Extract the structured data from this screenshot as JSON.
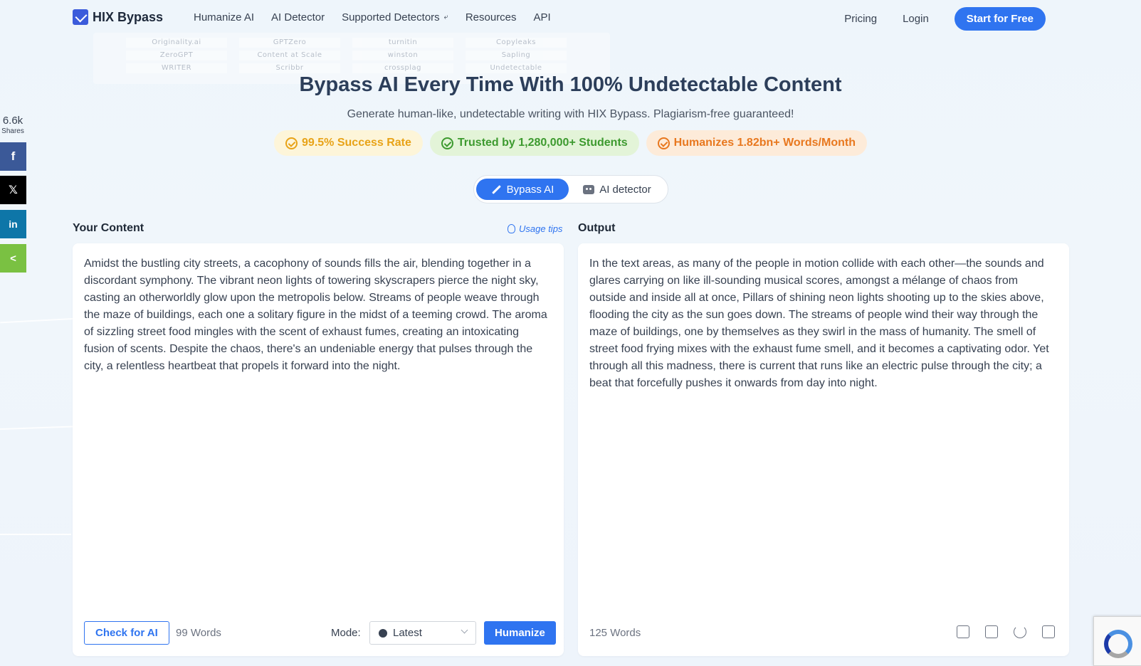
{
  "header": {
    "logo_text": "HIX Bypass",
    "nav": [
      "Humanize AI",
      "AI Detector",
      "Supported Detectors",
      "Resources",
      "API"
    ],
    "pricing": "Pricing",
    "login": "Login",
    "cta": "Start for Free"
  },
  "detectors": [
    "Originality.ai",
    "GPTZero",
    "turnitin",
    "Copyleaks",
    "ZeroGPT",
    "Content at Scale",
    "winston",
    "Sapling",
    "WRITER",
    "Scribbr",
    "crossplag",
    "Undetectable"
  ],
  "hero": {
    "title": "Bypass AI Every Time With 100% Undetectable Content",
    "subtitle": "Generate human-like, undetectable writing with HIX Bypass. Plagiarism-free guaranteed!",
    "badges": [
      "99.5% Success Rate",
      "Trusted by 1,280,000+ Students",
      "Humanizes 1.82bn+ Words/Month"
    ]
  },
  "toggle": {
    "active": "Bypass AI",
    "inactive": "AI detector"
  },
  "input": {
    "label": "Your Content",
    "tips": "Usage tips",
    "text": "Amidst the bustling city streets, a cacophony of sounds fills the air, blending together in a discordant symphony. The vibrant neon lights of towering skyscrapers pierce the night sky, casting an otherworldly glow upon the metropolis below. Streams of people weave through the maze of buildings, each one a solitary figure in the midst of a teeming crowd. The aroma of sizzling street food mingles with the scent of exhaust fumes, creating an intoxicating fusion of scents. Despite the chaos, there's an undeniable energy that pulses through the city, a relentless heartbeat that propels it forward into the night.",
    "check_button": "Check for AI",
    "word_count": "99 Words",
    "mode_label": "Mode:",
    "mode_value": "Latest",
    "humanize_button": "Humanize"
  },
  "output": {
    "label": "Output",
    "text": "In the text areas, as many of the people in motion collide with each other—the sounds and glares carrying on like ill-sounding musical scores, amongst a mélange of chaos from outside and inside all at once, Pillars of shining neon lights shooting up to the skies above, flooding the city as the sun goes down. The streams of people wind their way through the maze of buildings, one by themselves as they swirl in the mass of humanity. The smell of street food frying mixes with the exhaust fume smell, and it becomes a captivating odor. Yet through all this madness, there is current that runs like an electric pulse through the city; a beat that forcefully pushes it onwards from day into night.",
    "word_count": "125 Words"
  },
  "share": {
    "count": "6.6k",
    "label": "Shares",
    "fb": "f",
    "x": "𝕏",
    "in": "in",
    "sh": "<"
  },
  "colors": {
    "accent": "#2f74f0",
    "badge_yellow": "#e8a317",
    "badge_green": "#3d9a2f",
    "badge_orange": "#e8781f"
  }
}
